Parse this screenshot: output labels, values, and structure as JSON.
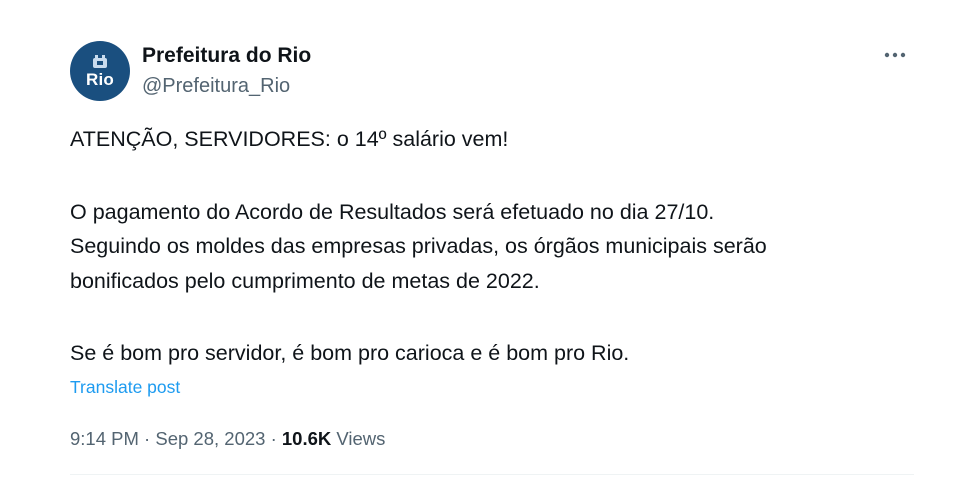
{
  "author": {
    "display_name": "Prefeitura do Rio",
    "handle": "@Prefeitura_Rio",
    "avatar_text": "Rio",
    "avatar_color": "#1a4f7f"
  },
  "more_icon": "more-horizontal-icon",
  "post": {
    "line1": "ATENÇÃO, SERVIDORES: o 14º salário vem!",
    "line2": "O pagamento do Acordo de Resultados será efetuado no dia 27/10.",
    "line3": "Seguindo os moldes das empresas privadas, os órgãos municipais serão",
    "line4": "bonificados pelo cumprimento de metas de 2022.",
    "line5": "Se é bom pro servidor, é bom pro carioca e é bom pro Rio."
  },
  "translate_label": "Translate post",
  "meta": {
    "time": "9:14 PM",
    "separator": "·",
    "date": "Sep 28, 2023",
    "views_count": "10.6K",
    "views_label": "Views"
  },
  "colors": {
    "text": "#0f1419",
    "secondary": "#536471",
    "link": "#1d9bf0"
  }
}
